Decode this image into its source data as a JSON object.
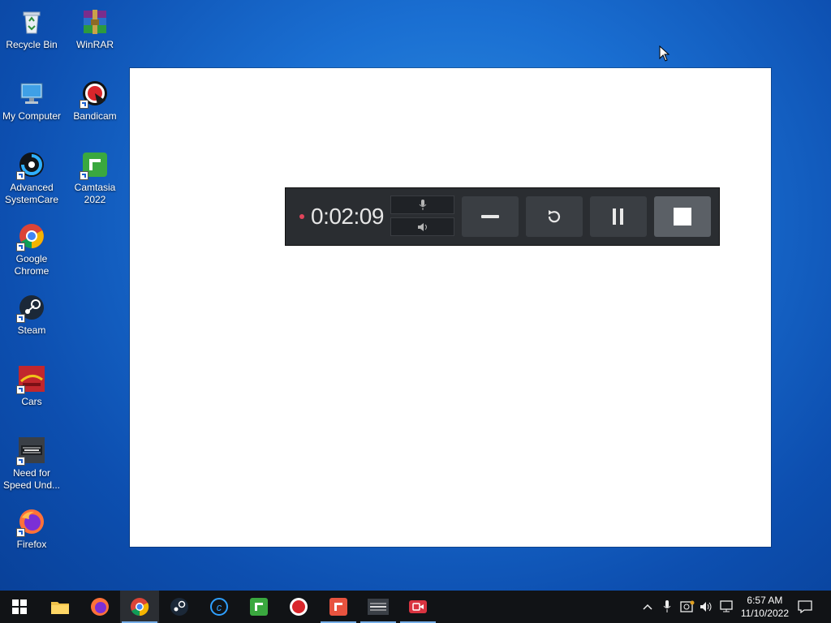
{
  "desktop": {
    "icons": [
      {
        "label": "Recycle Bin",
        "icon": "recycle-bin-icon"
      },
      {
        "label": "WinRAR",
        "icon": "winrar-icon"
      },
      {
        "label": "My Computer",
        "icon": "computer-icon"
      },
      {
        "label": "Bandicam",
        "icon": "bandicam-icon"
      },
      {
        "label": "Advanced SystemCare",
        "icon": "advanced-systemcare-icon"
      },
      {
        "label": "Camtasia 2022",
        "icon": "camtasia-icon"
      },
      {
        "label": "Google Chrome",
        "icon": "chrome-icon"
      },
      {
        "label": "Steam",
        "icon": "steam-icon"
      },
      {
        "label": "Cars",
        "icon": "cars-icon"
      },
      {
        "label": "Need for Speed Und...",
        "icon": "nfs-icon"
      },
      {
        "label": "Firefox",
        "icon": "firefox-icon"
      }
    ]
  },
  "recorder": {
    "time": "0:02:09",
    "recording_indicator_color": "#e0445a",
    "buttons": [
      "minimize-icon",
      "restart-icon",
      "pause-icon",
      "stop-icon"
    ]
  },
  "taskbar": {
    "apps": [
      "windows-start-icon",
      "file-explorer-icon",
      "firefox-icon",
      "chrome-icon",
      "steam-icon",
      "advanced-systemcare-icon",
      "camtasia-icon",
      "bandicam-icon",
      "camtasia-recorder-icon",
      "nfs-icon",
      "camtasia-rec-icon"
    ]
  },
  "tray": {
    "time": "6:57 AM",
    "date": "11/10/2022"
  },
  "colors": {
    "desktop": "#1a6fd2",
    "taskbar": "#111316",
    "recorder_bg": "#2a2d31"
  }
}
